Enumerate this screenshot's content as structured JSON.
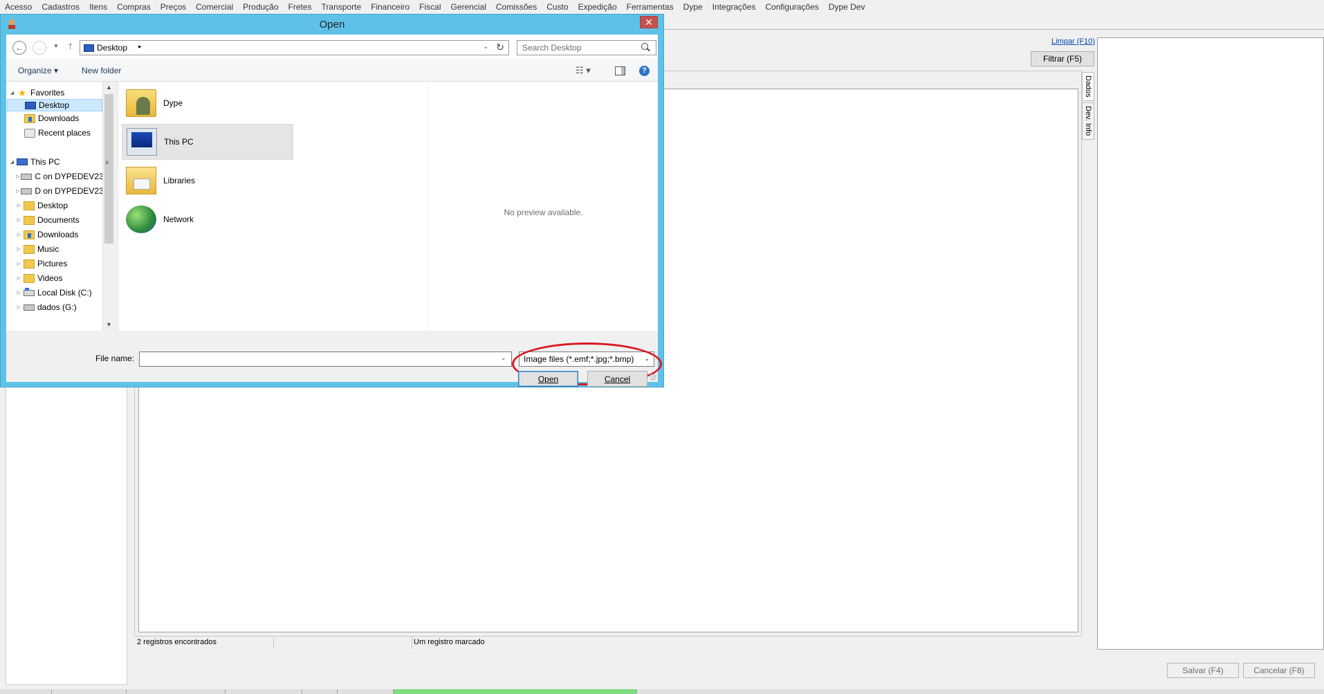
{
  "app": {
    "menu": [
      "Acesso",
      "Cadastros",
      "Itens",
      "Compras",
      "Preços",
      "Comercial",
      "Produção",
      "Fretes",
      "Transporte",
      "Financeiro",
      "Fiscal",
      "Gerencial",
      "Comissões",
      "Custo",
      "Expedição",
      "Ferramentas",
      "Dype",
      "Integrações",
      "Configurações",
      "Dype Dev"
    ],
    "limpar_link": "Limpar (F10)",
    "filtrar_button": "Filtrar (F5)",
    "side_tabs": [
      "Dados",
      "Dev. Info"
    ],
    "status": {
      "records_found": "2 registros encontrados",
      "middle": "",
      "marked": "Um registro marcado"
    },
    "salvar_button": "Salvar (F4)",
    "cancelar_button": "Cancelar (F8)"
  },
  "dialog": {
    "title": "Open",
    "close_glyph": "✕",
    "address": {
      "location": "Desktop",
      "separator": "▸",
      "dropdown": "⌄",
      "refresh": "↻"
    },
    "search_placeholder": "Search Desktop",
    "commands": {
      "organize": "Organize ▾",
      "new_folder": "New folder",
      "view": "☷ ▾",
      "help": "?"
    },
    "nav_tree": [
      {
        "label": "Favorites",
        "icon": "star-icon",
        "expander": "◢",
        "level": 0
      },
      {
        "label": "Desktop",
        "icon": "desktop-icon",
        "expander": "",
        "level": 1,
        "selected": true
      },
      {
        "label": "Downloads",
        "icon": "downloads-folder-icon",
        "expander": "",
        "level": 1
      },
      {
        "label": "Recent places",
        "icon": "recent-places-icon",
        "expander": "",
        "level": 1
      },
      {
        "label": "This PC",
        "icon": "computer-icon",
        "expander": "◢",
        "level": 0
      },
      {
        "label": "C on DYPEDEV23",
        "icon": "network-drive-icon",
        "expander": "▷",
        "level": 1
      },
      {
        "label": "D on DYPEDEV23",
        "icon": "network-drive-icon",
        "expander": "▷",
        "level": 1
      },
      {
        "label": "Desktop",
        "icon": "folder-icon",
        "expander": "▷",
        "level": 1
      },
      {
        "label": "Documents",
        "icon": "folder-icon",
        "expander": "▷",
        "level": 1
      },
      {
        "label": "Downloads",
        "icon": "downloads-folder-icon",
        "expander": "▷",
        "level": 1
      },
      {
        "label": "Music",
        "icon": "folder-icon",
        "expander": "▷",
        "level": 1
      },
      {
        "label": "Pictures",
        "icon": "folder-icon",
        "expander": "▷",
        "level": 1
      },
      {
        "label": "Videos",
        "icon": "folder-icon",
        "expander": "▷",
        "level": 1
      },
      {
        "label": "Local Disk (C:)",
        "icon": "local-disk-icon",
        "expander": "▷",
        "level": 1
      },
      {
        "label": "dados (G:)",
        "icon": "drive-icon",
        "expander": "▷",
        "level": 1
      }
    ],
    "scroll": {
      "up": "▲",
      "down": "▼",
      "grip": "≡"
    },
    "files": [
      {
        "name": "Dype",
        "icon": "user-folder-icon"
      },
      {
        "name": "This PC",
        "icon": "computer-icon",
        "selected": true
      },
      {
        "name": "Libraries",
        "icon": "libraries-icon"
      },
      {
        "name": "Network",
        "icon": "network-icon"
      }
    ],
    "preview_text": "No preview available.",
    "file_name_label": "File name:",
    "file_name_value": "",
    "file_name_dropdown": "⌄",
    "file_type": "Image files (*.emf;*.jpg;*.bmp)",
    "file_type_dropdown": "⌄",
    "open_button": "Open",
    "cancel_button": "Cancel",
    "highlight_color": "#d8181f"
  }
}
